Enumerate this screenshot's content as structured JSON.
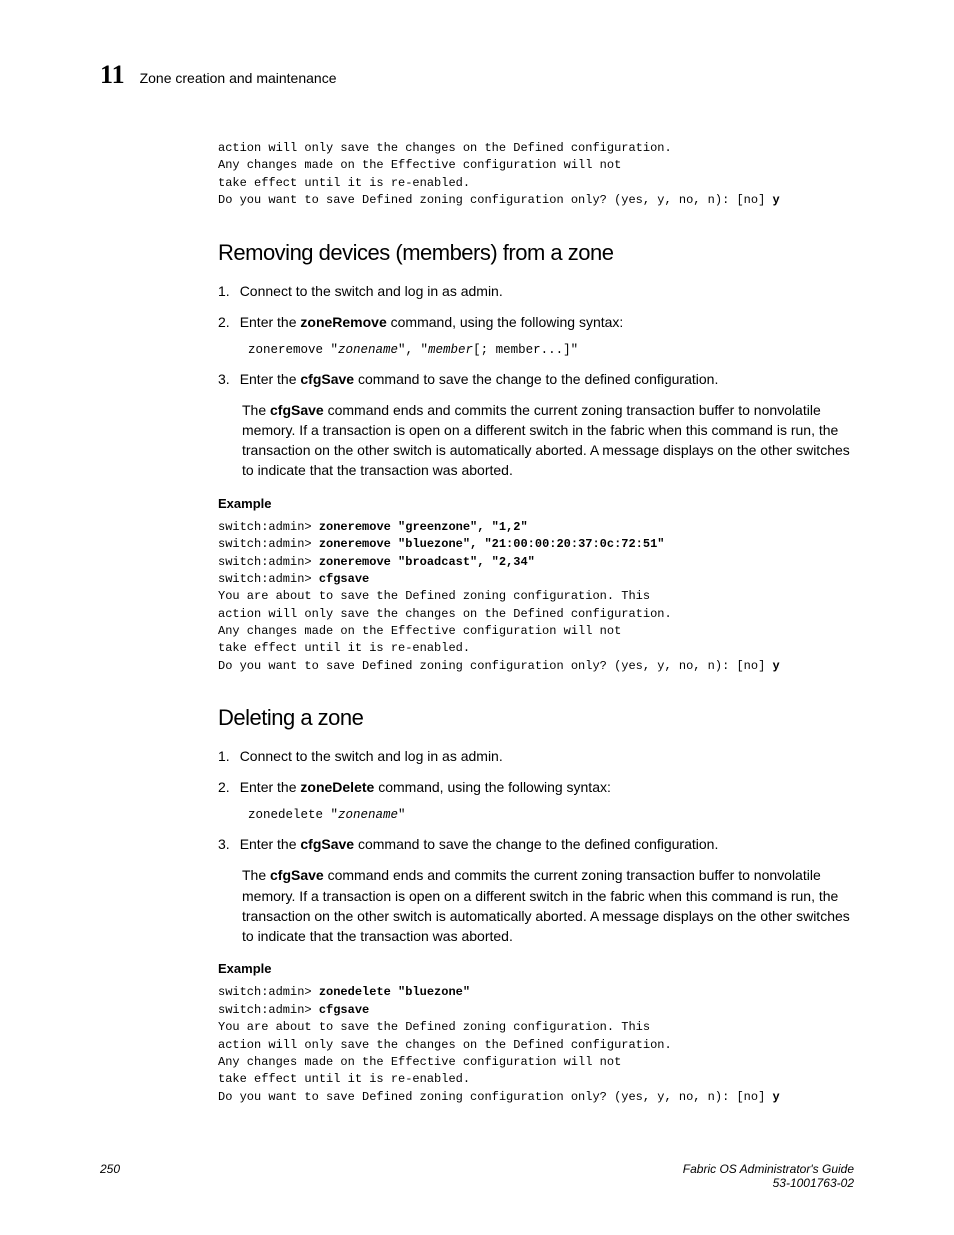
{
  "header": {
    "chapter_num": "11",
    "chapter_title": "Zone creation and maintenance"
  },
  "intro_code": {
    "line1": "action will only save the changes on the Defined configuration.",
    "line2": "Any changes made on the Effective configuration will not",
    "line3": "take effect until it is re-enabled.",
    "line4": "Do you want to save Defined zoning configuration only? (yes, y, no, n): [no] ",
    "line4_bold": "y"
  },
  "section1": {
    "heading": "Removing devices (members) from a zone",
    "step1": "Connect to the switch and log in as admin.",
    "step2_pre": "Enter the ",
    "step2_cmd": "zoneRemove",
    "step2_post": " command, using the following syntax:",
    "step2_code_pre": "zoneremove \"",
    "step2_code_italic1": "zonename",
    "step2_code_mid": "\", \"",
    "step2_code_italic2": "member",
    "step2_code_post": "[; member...]\"",
    "step3_pre": "Enter the ",
    "step3_cmd": "cfgSave",
    "step3_post": " command to save the change to the defined configuration.",
    "para_pre": "The ",
    "para_cmd": "cfgSave",
    "para_post": " command ends and commits the current zoning transaction buffer to nonvolatile memory. If a transaction is open on a different switch in the fabric when this command is run, the transaction on the other switch is automatically aborted. A message displays on the other switches to indicate that the transaction was aborted.",
    "example_label": "Example",
    "ex_l1a": "switch:admin> ",
    "ex_l1b": "zoneremove \"greenzone\", \"1,2\"",
    "ex_l2a": "switch:admin> ",
    "ex_l2b": "zoneremove \"bluezone\", \"21:00:00:20:37:0c:72:51\"",
    "ex_l3a": "switch:admin> ",
    "ex_l3b": "zoneremove \"broadcast\", \"2,34\"",
    "ex_l4a": "switch:admin> ",
    "ex_l4b": "cfgsave",
    "ex_l5": "You are about to save the Defined zoning configuration. This",
    "ex_l6": "action will only save the changes on the Defined configuration.",
    "ex_l7": "Any changes made on the Effective configuration will not",
    "ex_l8": "take effect until it is re-enabled.",
    "ex_l9": "Do you want to save Defined zoning configuration only? (yes, y, no, n): [no] ",
    "ex_l9b": "y"
  },
  "section2": {
    "heading": "Deleting a zone",
    "step1": "Connect to the switch and log in as admin.",
    "step2_pre": "Enter the ",
    "step2_cmd": "zoneDelete",
    "step2_post": " command, using the following syntax:",
    "step2_code_pre": "zonedelete \"",
    "step2_code_italic": "zonename",
    "step2_code_post": "\"",
    "step3_pre": "Enter the ",
    "step3_cmd": "cfgSave",
    "step3_post": " command to save the change to the defined configuration.",
    "para_pre": "The ",
    "para_cmd": "cfgSave",
    "para_post": " command ends and commits the current zoning transaction buffer to nonvolatile memory. If a transaction is open on a different switch in the fabric when this command is run, the transaction on the other switch is automatically aborted. A message displays on the other switches to indicate that the transaction was aborted.",
    "example_label": "Example",
    "ex_l1a": "switch:admin> ",
    "ex_l1b": "zonedelete \"bluezone\"",
    "ex_l2a": "switch:admin> ",
    "ex_l2b": "cfgsave",
    "ex_l3": "You are about to save the Defined zoning configuration. This",
    "ex_l4": "action will only save the changes on the Defined configuration.",
    "ex_l5": "Any changes made on the Effective configuration will not",
    "ex_l6": "take effect until it is re-enabled.",
    "ex_l7": "Do you want to save Defined zoning configuration only? (yes, y, no, n): [no] ",
    "ex_l7b": "y"
  },
  "footer": {
    "page_num": "250",
    "guide": "Fabric OS Administrator's Guide",
    "doc_id": "53-1001763-02"
  }
}
